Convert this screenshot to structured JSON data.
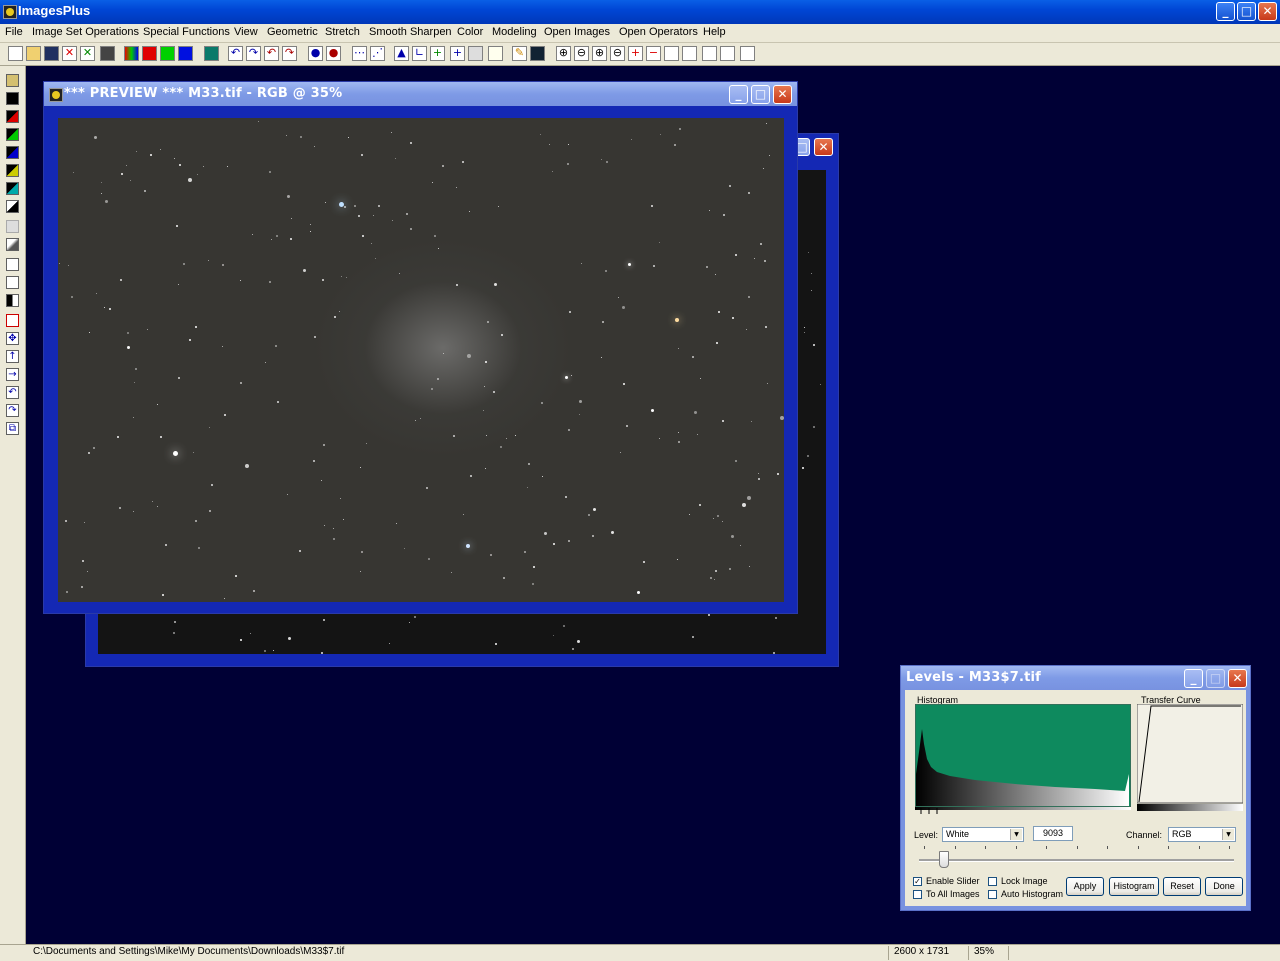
{
  "app": {
    "title": "ImagesPlus"
  },
  "menu": [
    "File",
    "Image Set Operations",
    "Special Functions",
    "View",
    "Geometric",
    "Stretch",
    "Smooth Sharpen",
    "Color",
    "Modeling",
    "Open Images",
    "Open Operators",
    "Help"
  ],
  "preview_window": {
    "title": "*** PREVIEW *** M33.tif - RGB @ 35%"
  },
  "levels": {
    "title": "Levels - M33$7.tif",
    "histogram_label": "Histogram",
    "transfer_label": "Transfer Curve",
    "level_label": "Level:",
    "level_value": "White",
    "level_number": "9093",
    "channel_label": "Channel:",
    "channel_value": "RGB",
    "slider_position": 0.08,
    "checkboxes": [
      {
        "label": "Enable Slider",
        "checked": true
      },
      {
        "label": "To All Images",
        "checked": false
      },
      {
        "label": "Lock Image",
        "checked": false
      },
      {
        "label": "Auto Histogram",
        "checked": false
      }
    ],
    "buttons": [
      "Apply",
      "Histogram",
      "Reset",
      "Done"
    ],
    "histogram_color": "#0e8a5e"
  },
  "status": {
    "path": "C:\\Documents and Settings\\Mike\\My Documents\\Downloads\\M33$7.tif",
    "dimensions": "2600 x 1731",
    "zoom": "35%"
  },
  "colors": {
    "desktop": "#000035",
    "window_frame": "#1428b4",
    "sky": "#373632"
  }
}
